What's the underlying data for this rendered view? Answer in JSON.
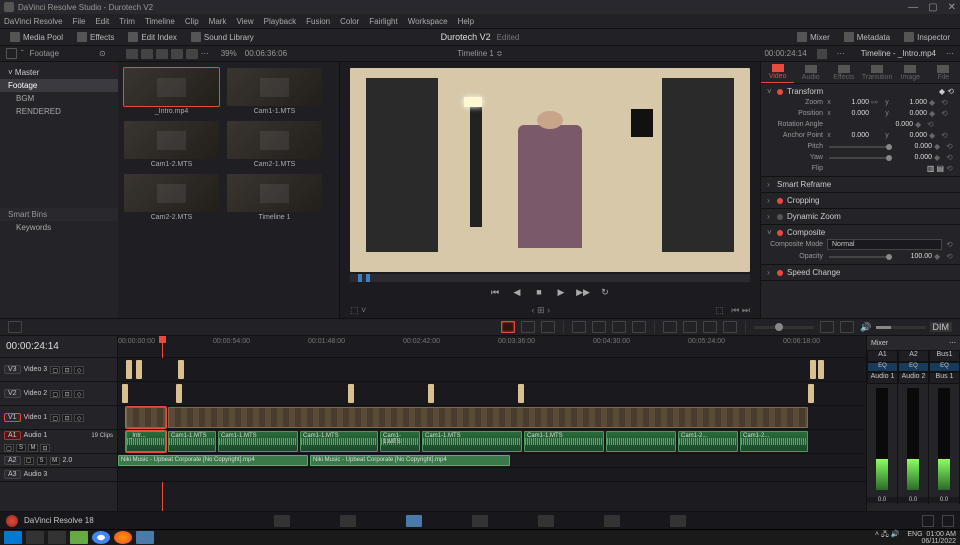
{
  "titlebar": {
    "title": "DaVinci Resolve Studio - Durotech V2"
  },
  "menu": [
    "DaVinci Resolve",
    "File",
    "Edit",
    "Trim",
    "Timeline",
    "Clip",
    "Mark",
    "View",
    "Playback",
    "Fusion",
    "Color",
    "Fairlight",
    "Workspace",
    "Help"
  ],
  "toptoolbar": {
    "media_pool": "Media Pool",
    "effects": "Effects",
    "edit_index": "Edit Index",
    "sound_library": "Sound Library",
    "project": "Durotech V2",
    "edited": "Edited",
    "mixer": "Mixer",
    "metadata": "Metadata",
    "inspector": "Inspector"
  },
  "subtoolbar": {
    "folder": "Footage",
    "zoom_pct": "39%",
    "src_tc": "00:06:36:06",
    "timeline_sel": "Timeline 1 ≎",
    "rec_tc": "00:00:24:14",
    "insp_title": "Timeline - _Intro.mp4"
  },
  "tree": {
    "master": "Master",
    "items": [
      "Footage",
      "BGM",
      "RENDERED"
    ],
    "smartbins": "Smart Bins",
    "keywords": "Keywords"
  },
  "clips": [
    {
      "name": "_Intro.mp4",
      "sel": true
    },
    {
      "name": "Cam1-1.MTS"
    },
    {
      "name": "Cam1-2.MTS"
    },
    {
      "name": "Cam2-1.MTS"
    },
    {
      "name": "Cam2-2.MTS"
    },
    {
      "name": "Timeline 1"
    }
  ],
  "inspector": {
    "tabs": [
      "Video",
      "Audio",
      "Effects",
      "Transition",
      "Image",
      "File"
    ],
    "transform": "Transform",
    "zoom": {
      "label": "Zoom",
      "x": "1.000",
      "y": "1.000"
    },
    "position": {
      "label": "Position",
      "x": "0.000",
      "y": "0.000"
    },
    "rotation": {
      "label": "Rotation Angle",
      "v": "0.000"
    },
    "anchor": {
      "label": "Anchor Point",
      "x": "0.000",
      "y": "0.000"
    },
    "pitch": {
      "label": "Pitch",
      "v": "0.000"
    },
    "yaw": {
      "label": "Yaw",
      "v": "0.000"
    },
    "flip": {
      "label": "Flip"
    },
    "smart_reframe": "Smart Reframe",
    "cropping": "Cropping",
    "dynamic_zoom": "Dynamic Zoom",
    "composite": "Composite",
    "composite_mode_label": "Composite Mode",
    "composite_mode": "Normal",
    "opacity_label": "Opacity",
    "opacity": "100.00",
    "speed_change": "Speed Change"
  },
  "timeline": {
    "tc": "00:00:24:14",
    "ticks": [
      "00:00:00:00",
      "00:00:54:00",
      "00:01:48:00",
      "00:02:42:00",
      "00:03:36:00",
      "00:04:30:00",
      "00:05:24:00",
      "00:06:18:00"
    ],
    "tracks": {
      "v3": {
        "tag": "V3",
        "name": "Video 3"
      },
      "v2": {
        "tag": "V2",
        "name": "Video 2"
      },
      "v1": {
        "tag": "V1",
        "name": "Video 1"
      },
      "a1": {
        "tag": "A1",
        "name": "Audio 1"
      },
      "a2": {
        "tag": "A2",
        "name": "2.0"
      },
      "a3": {
        "tag": "A3",
        "name": "Audio 3"
      }
    },
    "clips_info": "19 Clips",
    "v1_clip": "_Intr...",
    "a2_clip": "Niki Music - Upbeat Corporate [No Copyright].mp4",
    "a2_clip2": "Niki Music - Upbeat Corporate [No Copyright].mp4",
    "cam_labels": [
      "Cam1-1.MTS",
      "Cam1-1.MTS",
      "Cam1-1.MTS",
      "Cam1-1.MTS",
      "Cam1-1.MTS",
      "Cam1-1.MTS",
      "Cam1-2...",
      "Cam1-2..."
    ]
  },
  "mixer": {
    "title": "Mixer",
    "buses": [
      "A1",
      "A2",
      "Bus1"
    ],
    "eq": "EQ",
    "chs": [
      "Audio 1",
      "Audio 2",
      "Bus 1"
    ]
  },
  "pages": {
    "app": "DaVinci Resolve 18"
  },
  "taskbar": {
    "lang": "ENG",
    "time": "01:00 AM",
    "date": "06/11/2022"
  }
}
